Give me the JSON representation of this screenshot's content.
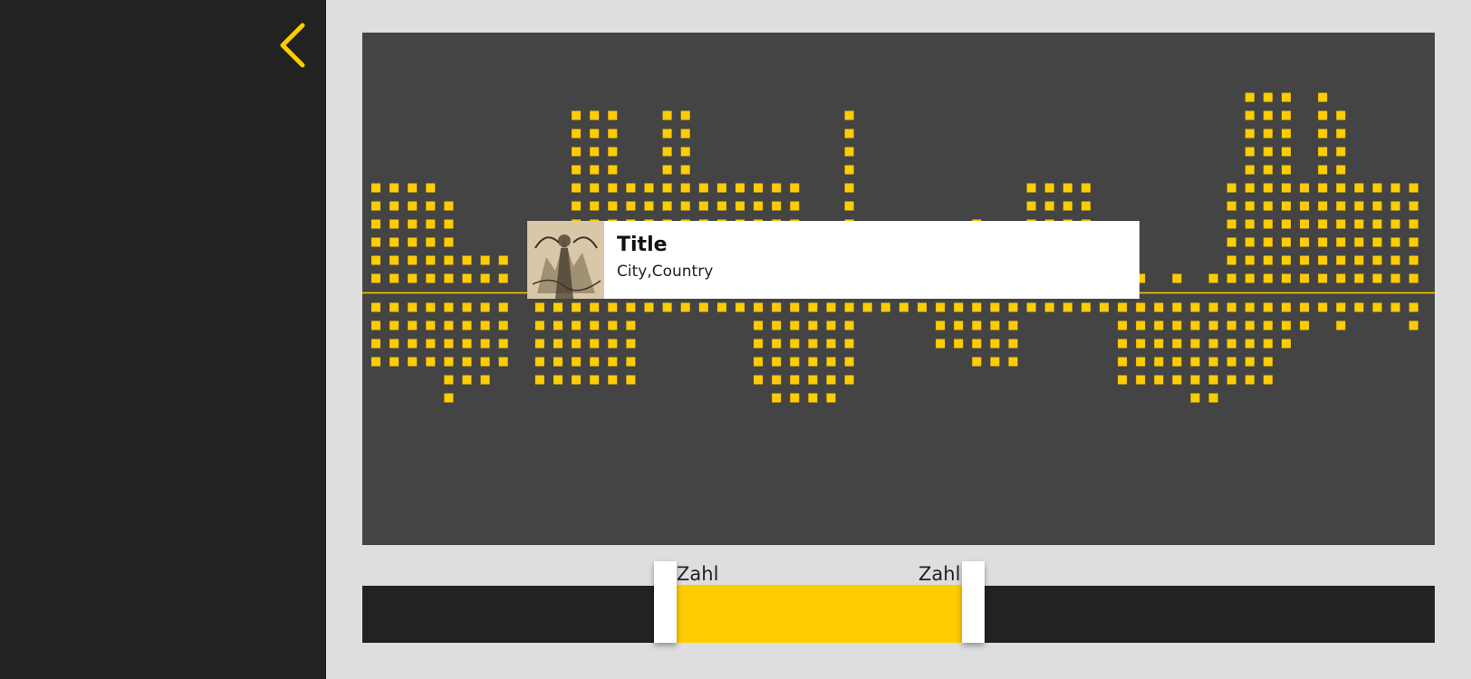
{
  "colors": {
    "accent": "#ffcc00",
    "sidebar": "#222222",
    "chart_background": "#444444",
    "page_background": "#dedede"
  },
  "navigation": {
    "back_icon": "chevron-left-icon"
  },
  "tooltip": {
    "title": "Title",
    "subtitle": "City,Country",
    "thumbnail_icon": "artwork-thumbnail"
  },
  "range_slider": {
    "start_label": "Zahl",
    "end_label": "Zahl",
    "range_fraction": [
      0.27,
      0.56
    ]
  },
  "chart_data": {
    "type": "bar",
    "style": "dot-matrix mirrored bars around a center baseline",
    "unit_per_dot": 1,
    "series": [
      {
        "direction": "up",
        "values": [
          6,
          6,
          6,
          6,
          5,
          2,
          2,
          2,
          0,
          0,
          0,
          10,
          10,
          10,
          6,
          6,
          10,
          10,
          6,
          6,
          6,
          6,
          6,
          6,
          0,
          0,
          10,
          0,
          0,
          0,
          0,
          0,
          0,
          4,
          0,
          0,
          6,
          6,
          6,
          6,
          0,
          0,
          1,
          0,
          1,
          0,
          1,
          6,
          11,
          11,
          11,
          6,
          11,
          10,
          6,
          6,
          6,
          6
        ]
      },
      {
        "direction": "down",
        "values": [
          4,
          4,
          4,
          4,
          6,
          5,
          5,
          4,
          0,
          5,
          5,
          5,
          5,
          5,
          5,
          1,
          1,
          1,
          1,
          1,
          1,
          5,
          6,
          6,
          6,
          6,
          5,
          1,
          1,
          1,
          1,
          3,
          3,
          4,
          4,
          4,
          1,
          1,
          1,
          1,
          1,
          5,
          5,
          5,
          5,
          6,
          6,
          5,
          5,
          5,
          3,
          2,
          1,
          2,
          1,
          1,
          1,
          2
        ]
      }
    ]
  }
}
